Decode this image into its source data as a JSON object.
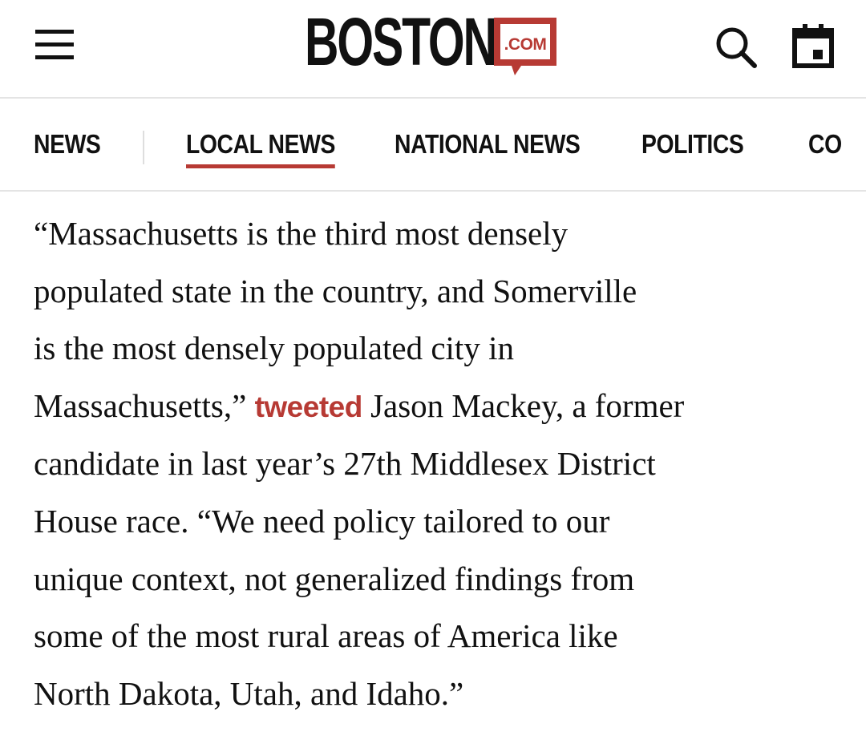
{
  "header": {
    "logo_word": "BOSTON",
    "logo_badge": ".COM",
    "brand_color": "#b73a34",
    "icons": [
      "menu-icon",
      "search-icon",
      "calendar-icon"
    ]
  },
  "nav": {
    "items": [
      {
        "label": "NEWS"
      },
      {
        "label": "LOCAL NEWS",
        "active": true
      },
      {
        "label": "NATIONAL NEWS"
      },
      {
        "label": "POLITICS"
      },
      {
        "label": "CO"
      }
    ],
    "active_color": "#b73a34"
  },
  "article": {
    "lines": [
      "“Massachusetts is the third most densely",
      "populated state in the country, and Somerville",
      "is the most densely populated city in"
    ],
    "line4_before": "Massachusetts,” ",
    "link_text": "tweeted",
    "line4_after": " Jason Mackey, a former",
    "lines_after": [
      "candidate in last year’s 27th Middlesex District",
      "House race. “We need policy tailored to our",
      "unique context, not generalized findings from",
      "some of the most rural areas of America like",
      "North Dakota, Utah, and Idaho.”"
    ]
  }
}
